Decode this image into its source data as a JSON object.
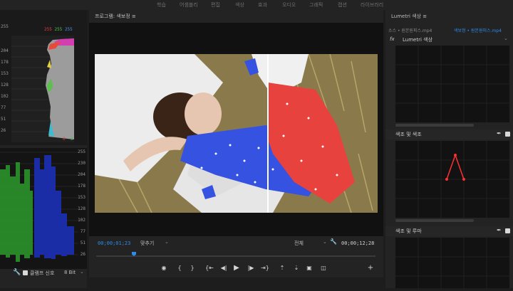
{
  "menu": [
    "학습",
    "어셈블리",
    "편집",
    "색상",
    "효과",
    "오디오",
    "그래픽",
    "캡션",
    "라이브러리"
  ],
  "histogram": {
    "rgb": [
      "255",
      "255",
      "255"
    ],
    "ticks": [
      "255",
      "230",
      "204",
      "178",
      "153",
      "128",
      "102",
      "77",
      "51",
      "26"
    ],
    "bottom": [
      "0",
      "0"
    ]
  },
  "waveform": {
    "ticks": [
      "255",
      "230",
      "204",
      "178",
      "153",
      "128",
      "102",
      "77",
      "51",
      "26"
    ],
    "clamp_label": "클램프 신호",
    "bit_depth": "8 Bit"
  },
  "program": {
    "title": "프로그램: 색보정",
    "menu_glyph": "≡",
    "timecode_current": "00;00;01;23",
    "fit": "맞추기",
    "quality": "전체",
    "timecode_duration": "00;00;12;28"
  },
  "lumetri": {
    "title": "Lumetri 색상",
    "menu_glyph": "≡",
    "source_label": "소스 • 원본원피스.mp4",
    "seq_label": "색보정 • 원본원피스.mp4",
    "fx": "fx",
    "effect_name": "Lumetri 색상",
    "sec_hue_sat": "색조 및 색조",
    "sec_hue_lum": "색조 및 루마"
  },
  "colors": {
    "accent": "#2d8ceb",
    "red": "#e23c3c",
    "dress_red": "#e8423f",
    "dress_blue": "#3552e0"
  }
}
